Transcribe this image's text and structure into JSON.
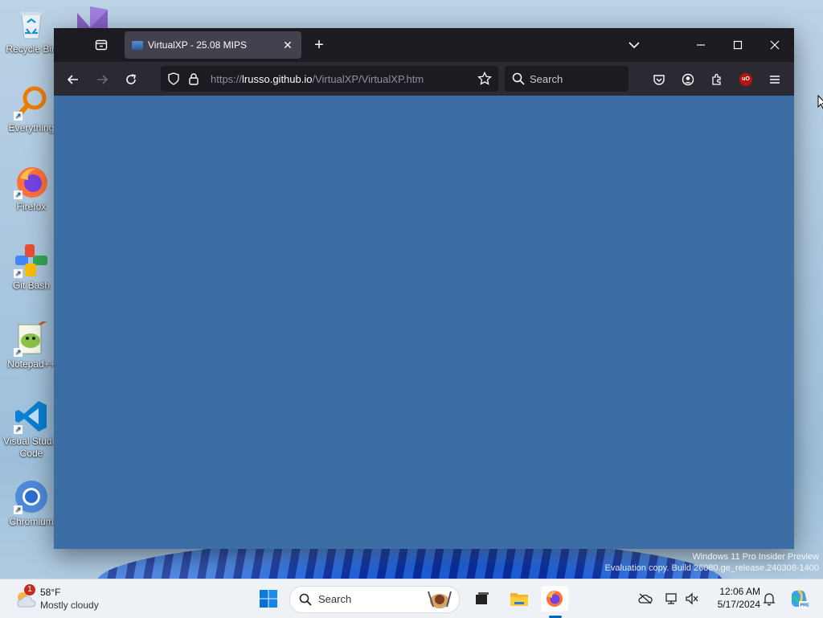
{
  "desktop": {
    "icons": [
      {
        "label": "Recycle Bin"
      },
      {
        "label": "Everything"
      },
      {
        "label": "Firefox"
      },
      {
        "label": "Git Bash"
      },
      {
        "label": "Notepad++"
      },
      {
        "label": "Visual Studio Code"
      },
      {
        "label": "Chromium"
      }
    ],
    "watermark": {
      "line1": "Windows 11 Pro Insider Preview",
      "line2": "Evaluation copy. Build 26080.ge_release.240308-1400"
    }
  },
  "browser": {
    "tab": {
      "title": "VirtualXP - 25.08 MIPS"
    },
    "url": {
      "scheme": "https://",
      "host": "lrusso.github.io",
      "path": "/VirtualXP/VirtualXP.htm"
    },
    "search": {
      "placeholder": "Search"
    },
    "content_color": "#3c6ea5",
    "extension_badge": "uO"
  },
  "taskbar": {
    "weather": {
      "temp": "58°F",
      "condition": "Mostly cloudy",
      "badge": "1"
    },
    "search": {
      "placeholder": "Search"
    },
    "clock": {
      "time": "12:06 AM",
      "date": "5/17/2024"
    }
  }
}
